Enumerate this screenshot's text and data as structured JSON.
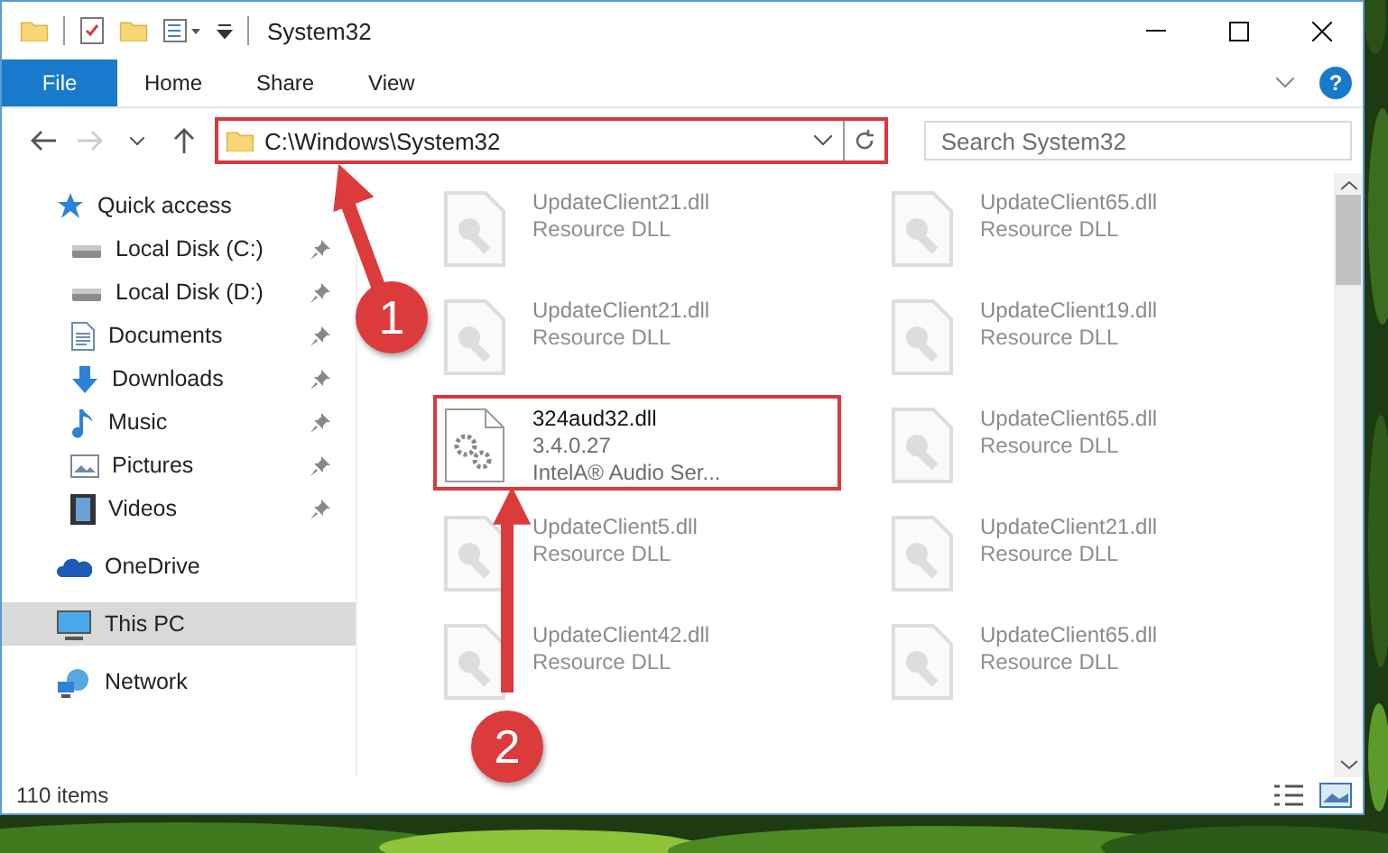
{
  "window": {
    "title": "System32"
  },
  "ribbon": {
    "tabs": [
      {
        "label": "File",
        "selected": true
      },
      {
        "label": "Home",
        "selected": false
      },
      {
        "label": "Share",
        "selected": false
      },
      {
        "label": "View",
        "selected": false
      }
    ],
    "help": "?"
  },
  "address_bar": {
    "path": "C:\\Windows\\System32",
    "annotated": true
  },
  "search": {
    "placeholder": "Search System32"
  },
  "sidebar": {
    "items": [
      {
        "label": "Quick access",
        "kind": "star",
        "selected": false,
        "children": [
          {
            "label": "Local Disk (C:)",
            "kind": "drive",
            "pinned": true,
            "selected": false
          },
          {
            "label": "Local Disk (D:)",
            "kind": "drive",
            "pinned": true,
            "selected": false
          },
          {
            "label": "Documents",
            "kind": "documents",
            "pinned": true,
            "selected": false
          },
          {
            "label": "Downloads",
            "kind": "downloads",
            "pinned": true,
            "selected": false
          },
          {
            "label": "Music",
            "kind": "music",
            "pinned": true,
            "selected": false
          },
          {
            "label": "Pictures",
            "kind": "pictures",
            "pinned": true,
            "selected": false
          },
          {
            "label": "Videos",
            "kind": "videos",
            "pinned": true,
            "selected": false
          }
        ]
      },
      {
        "label": "OneDrive",
        "kind": "cloud",
        "selected": false
      },
      {
        "label": "This PC",
        "kind": "computer",
        "selected": true
      },
      {
        "label": "Network",
        "kind": "network",
        "selected": false
      }
    ]
  },
  "files": [
    {
      "name": "UpdateClient21.dll",
      "details": [
        "Resource DLL"
      ],
      "dimmed": true,
      "annotated": false
    },
    {
      "name": "UpdateClient65.dll",
      "details": [
        "Resource DLL"
      ],
      "dimmed": true,
      "annotated": false
    },
    {
      "name": "UpdateClient21.dll",
      "details": [
        "Resource DLL"
      ],
      "dimmed": true,
      "annotated": false
    },
    {
      "name": "UpdateClient19.dll",
      "details": [
        "Resource DLL"
      ],
      "dimmed": true,
      "annotated": false
    },
    {
      "name": "324aud32.dll",
      "details": [
        "3.4.0.27",
        "IntelA® Audio Ser..."
      ],
      "dimmed": false,
      "annotated": true
    },
    {
      "name": "UpdateClient65.dll",
      "details": [
        "Resource DLL"
      ],
      "dimmed": true,
      "annotated": false
    },
    {
      "name": "UpdateClient5.dll",
      "details": [
        "Resource DLL"
      ],
      "dimmed": true,
      "annotated": false
    },
    {
      "name": "UpdateClient21.dll",
      "details": [
        "Resource DLL"
      ],
      "dimmed": true,
      "annotated": false
    },
    {
      "name": "UpdateClient42.dll",
      "details": [
        "Resource DLL"
      ],
      "dimmed": true,
      "annotated": false
    },
    {
      "name": "UpdateClient65.dll",
      "details": [
        "Resource DLL"
      ],
      "dimmed": true,
      "annotated": false
    }
  ],
  "status_bar": {
    "count": "110 items"
  },
  "annotations": [
    {
      "label": "1"
    },
    {
      "label": "2"
    }
  ]
}
